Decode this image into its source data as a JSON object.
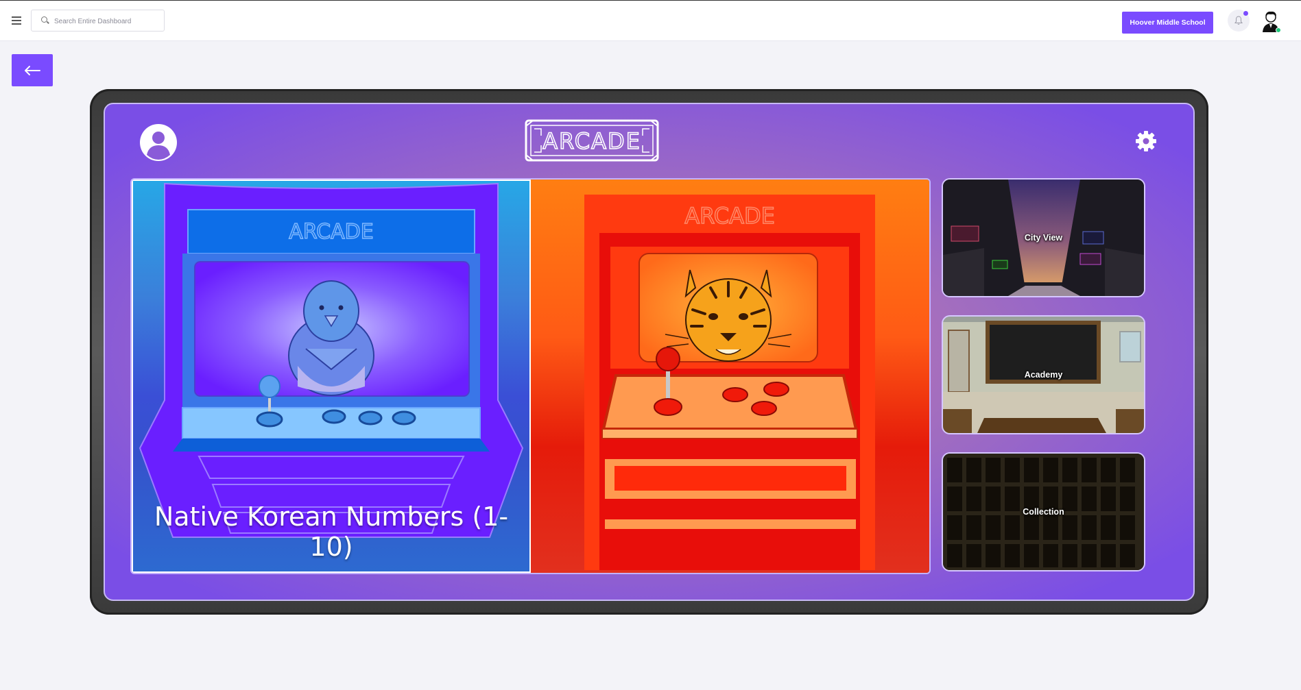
{
  "topbar": {
    "menu_icon": "hamburger-menu-icon",
    "search_placeholder": "Search Entire Dashboard",
    "school_button": "Hoover Middle School",
    "notification_icon": "bell-icon",
    "avatar_icon": "user-avatar-icon"
  },
  "back_button": {
    "icon": "arrow-left-icon"
  },
  "arcade": {
    "logo_text": "ARCADE",
    "profile_icon": "user-circle-icon",
    "settings_icon": "gear-icon",
    "games": [
      {
        "title": "Native Korean Numbers (1-10)",
        "theme": "blue",
        "mascot": "bird"
      },
      {
        "title": "",
        "theme": "orange",
        "mascot": "tiger"
      }
    ],
    "side_cards": [
      {
        "label": "City View"
      },
      {
        "label": "Academy"
      },
      {
        "label": "Collection"
      }
    ]
  },
  "colors": {
    "accent": "#7a4bff",
    "screen_purple": "#7a4ee6",
    "blue_cabinet": "#6a1fff",
    "orange_cabinet": "#ff3a10"
  }
}
